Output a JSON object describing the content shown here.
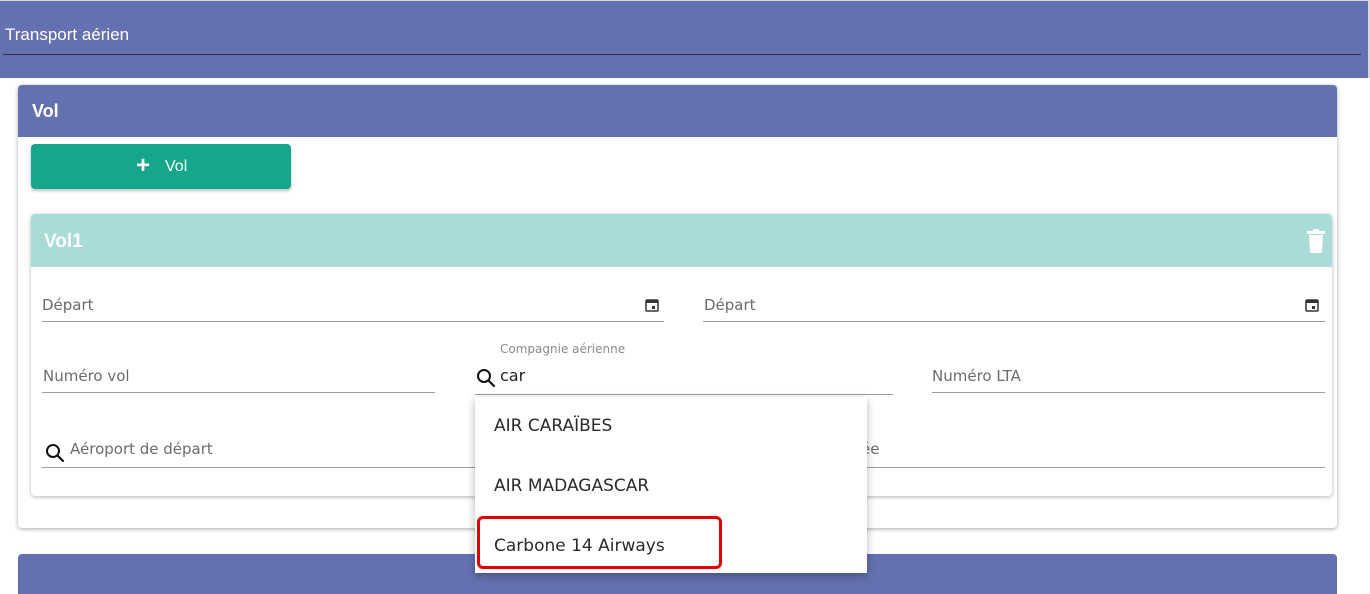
{
  "topbar": {
    "title": "Transport aérien"
  },
  "section": {
    "title": "Vol",
    "add_button_label": "Vol"
  },
  "flight": {
    "title": "Vol1",
    "fields": {
      "depart_date_1": {
        "placeholder": "Départ"
      },
      "depart_date_2": {
        "placeholder": "Départ"
      },
      "numero_vol": {
        "placeholder": "Numéro vol"
      },
      "compagnie": {
        "label": "Compagnie aérienne",
        "value": "car"
      },
      "numero_lta": {
        "placeholder": "Numéro LTA"
      },
      "aeroport_depart": {
        "placeholder": "Aéroport de départ"
      },
      "aeroport_arrivee": {
        "placeholder_visible": "ée"
      }
    }
  },
  "dropdown": {
    "options": [
      "AIR CARAÏBES",
      "AIR MADAGASCAR",
      "Carbone 14 Airways"
    ],
    "highlighted_option": "Carbone 14 Airways"
  },
  "colors": {
    "header": "#6471b0",
    "accent_button": "#16a689",
    "sub_header": "#a9dcd8",
    "highlight_border": "#e00000"
  },
  "icons": [
    "plus-icon",
    "trash-icon",
    "calendar-icon",
    "search-icon"
  ]
}
